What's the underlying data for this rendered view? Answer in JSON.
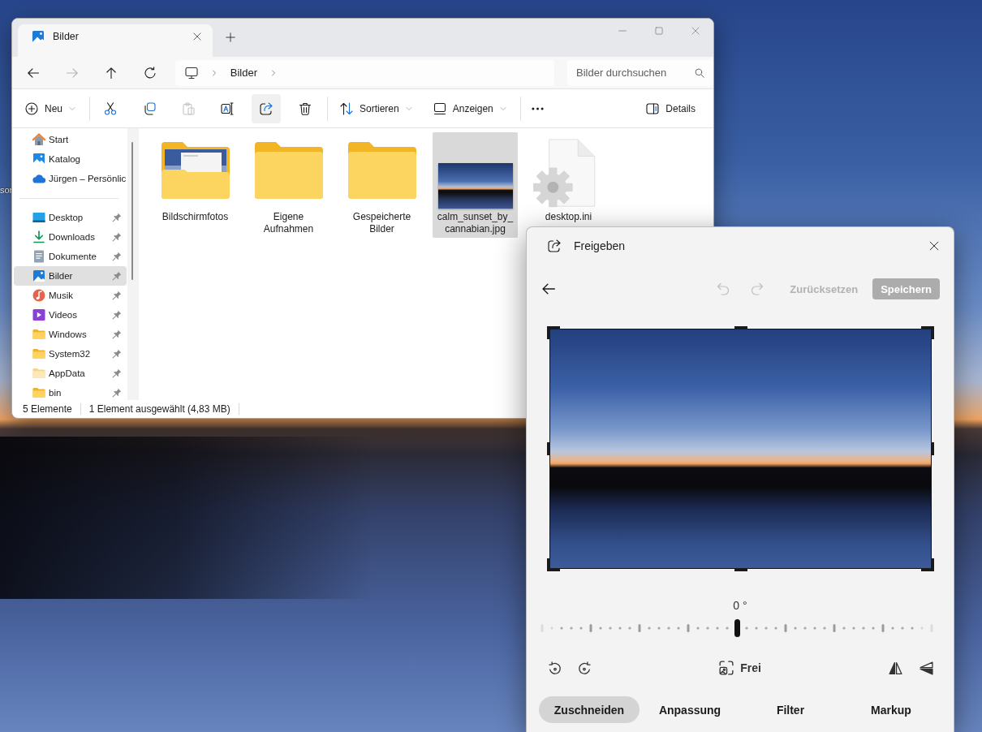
{
  "desktop": {
    "icon_label": "sor"
  },
  "explorer": {
    "tabs": [
      {
        "kind": "pictures",
        "label": "Bilder",
        "selected": true
      }
    ],
    "nav_buttons": [
      {
        "kind": "back",
        "disabled": false
      },
      {
        "kind": "forward",
        "disabled": true
      },
      {
        "kind": "up",
        "disabled": false
      },
      {
        "kind": "refresh",
        "disabled": false
      }
    ],
    "breadcrumb": [
      "Bilder"
    ],
    "search": {
      "placeholder": "Bilder durchsuchen"
    },
    "toolbar": {
      "new": {
        "label": "Neu"
      },
      "actions": [
        {
          "kind": "cut",
          "disabled": false,
          "pressed": false
        },
        {
          "kind": "copy",
          "disabled": false,
          "pressed": false
        },
        {
          "kind": "paste",
          "disabled": true,
          "pressed": false
        },
        {
          "kind": "rename",
          "disabled": false,
          "pressed": false
        },
        {
          "kind": "share",
          "disabled": false,
          "pressed": true
        },
        {
          "kind": "delete",
          "disabled": false,
          "pressed": false
        }
      ],
      "menus": [
        {
          "kind": "sort",
          "label": "Sortieren"
        },
        {
          "kind": "view",
          "label": "Anzeigen"
        }
      ],
      "details": {
        "label": "Details"
      }
    },
    "sidebar": {
      "sections": [
        {
          "items": [
            {
              "kind": "home",
              "label": "Start",
              "pinned": false,
              "selected": false
            },
            {
              "kind": "gallery",
              "label": "Katalog",
              "pinned": false,
              "selected": false
            },
            {
              "kind": "cloud",
              "label": "Jürgen – Persönlic",
              "pinned": false,
              "selected": false
            }
          ]
        },
        {
          "items": [
            {
              "kind": "desktop",
              "label": "Desktop",
              "pinned": true,
              "selected": false
            },
            {
              "kind": "download",
              "label": "Downloads",
              "pinned": true,
              "selected": false
            },
            {
              "kind": "documents",
              "label": "Dokumente",
              "pinned": true,
              "selected": false
            },
            {
              "kind": "pictures",
              "label": "Bilder",
              "pinned": true,
              "selected": true
            },
            {
              "kind": "music",
              "label": "Musik",
              "pinned": true,
              "selected": false
            },
            {
              "kind": "videos",
              "label": "Videos",
              "pinned": true,
              "selected": false
            },
            {
              "kind": "folder",
              "label": "Windows",
              "pinned": true,
              "selected": false
            },
            {
              "kind": "folder",
              "label": "System32",
              "pinned": true,
              "selected": false
            },
            {
              "kind": "folder-light",
              "label": "AppData",
              "pinned": true,
              "selected": false
            },
            {
              "kind": "folder",
              "label": "bin",
              "pinned": true,
              "selected": false
            }
          ]
        }
      ]
    },
    "files": [
      {
        "kind": "folder-preview",
        "label": "Bildschirmfotos",
        "selected": false
      },
      {
        "kind": "folder",
        "label": "Eigene Aufnahmen",
        "selected": false
      },
      {
        "kind": "folder",
        "label": "Gespeicherte Bilder",
        "selected": false
      },
      {
        "kind": "image",
        "label": "calm_sunset_by_cannabian.jpg",
        "selected": true
      },
      {
        "kind": "settings-file",
        "label": "desktop.ini",
        "selected": false
      }
    ],
    "status_bar": {
      "count": "5 Elemente",
      "selection": "1 Element ausgewählt (4,83 MB)"
    }
  },
  "share_dialog": {
    "title": "Freigeben",
    "history": [
      {
        "kind": "undo",
        "disabled": true
      },
      {
        "kind": "redo",
        "disabled": true
      }
    ],
    "reset": {
      "label": "Zurücksetzen",
      "disabled": true
    },
    "save": {
      "label": "Speichern",
      "disabled": true
    },
    "rotation": {
      "reading": "0 °",
      "level": 0.5
    },
    "rotate_buttons": [
      {
        "kind": "rotate-left"
      },
      {
        "kind": "rotate-right"
      }
    ],
    "aspect": {
      "label": "Frei"
    },
    "flip_buttons": [
      {
        "kind": "flip-horizontal"
      },
      {
        "kind": "flip-vertical"
      }
    ],
    "tabs": [
      {
        "label": "Zuschneiden",
        "selected": true
      },
      {
        "label": "Anpassung",
        "selected": false
      },
      {
        "label": "Filter",
        "selected": false
      },
      {
        "label": "Markup",
        "selected": false
      }
    ]
  }
}
